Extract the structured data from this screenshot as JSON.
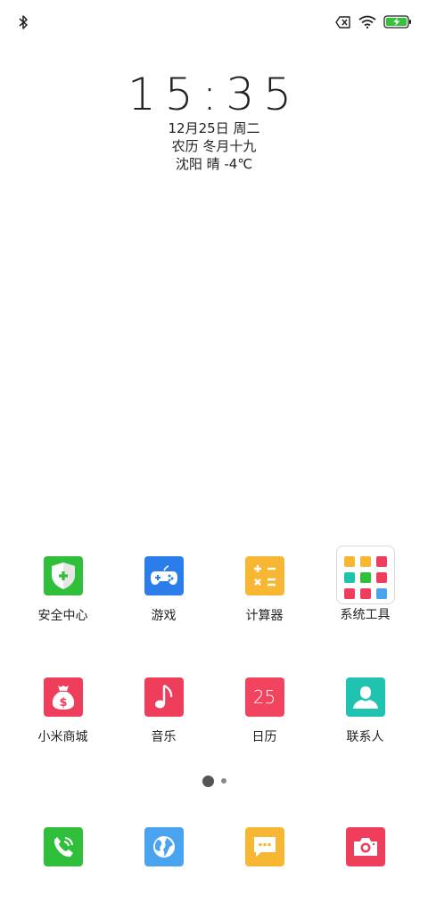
{
  "status_bar": {
    "left_icon": "bluetooth-icon",
    "right_icons": [
      "no-sim-icon",
      "wifi-icon",
      "battery-charging-icon"
    ],
    "accent_battery": "#35c23b"
  },
  "lock_info": {
    "time": "15:35",
    "date": "12月25日 周二",
    "lunar": "农历 冬月十九",
    "weather": "沈阳 晴 -4℃"
  },
  "apps_row1": [
    {
      "label": "安全中心",
      "icon": "shield-plus-icon",
      "color": "#2fbf3a"
    },
    {
      "label": "游戏",
      "icon": "gamepad-icon",
      "color": "#2b7de9"
    },
    {
      "label": "计算器",
      "icon": "calculator-icon",
      "color": "#f7b733"
    },
    {
      "label": "系统工具",
      "icon": "folder-icon",
      "color": "#ffffff"
    }
  ],
  "apps_row2": [
    {
      "label": "小米商城",
      "icon": "money-bag-icon",
      "color": "#ee3e5b"
    },
    {
      "label": "音乐",
      "icon": "music-note-icon",
      "color": "#ee3e5b"
    },
    {
      "label": "日历",
      "icon": "calendar-icon",
      "color": "#f2435f",
      "day": "25"
    },
    {
      "label": "联系人",
      "icon": "contact-person-icon",
      "color": "#20c2b0"
    }
  ],
  "dock": [
    {
      "icon": "phone-icon",
      "color": "#2fbf3a"
    },
    {
      "icon": "browser-globe-icon",
      "color": "#4aa3ef"
    },
    {
      "icon": "message-icon",
      "color": "#f7b733"
    },
    {
      "icon": "camera-icon",
      "color": "#ee3e5b"
    }
  ],
  "page_indicator": {
    "pages": 2,
    "current": 1
  },
  "folder_colors": [
    "#f7b733",
    "#f7b733",
    "#ee3e5b",
    "#20c2b0",
    "#2fbf3a",
    "#ee3e5b",
    "#ee3e5b",
    "#ee3e5b",
    "#4aa3ef"
  ]
}
